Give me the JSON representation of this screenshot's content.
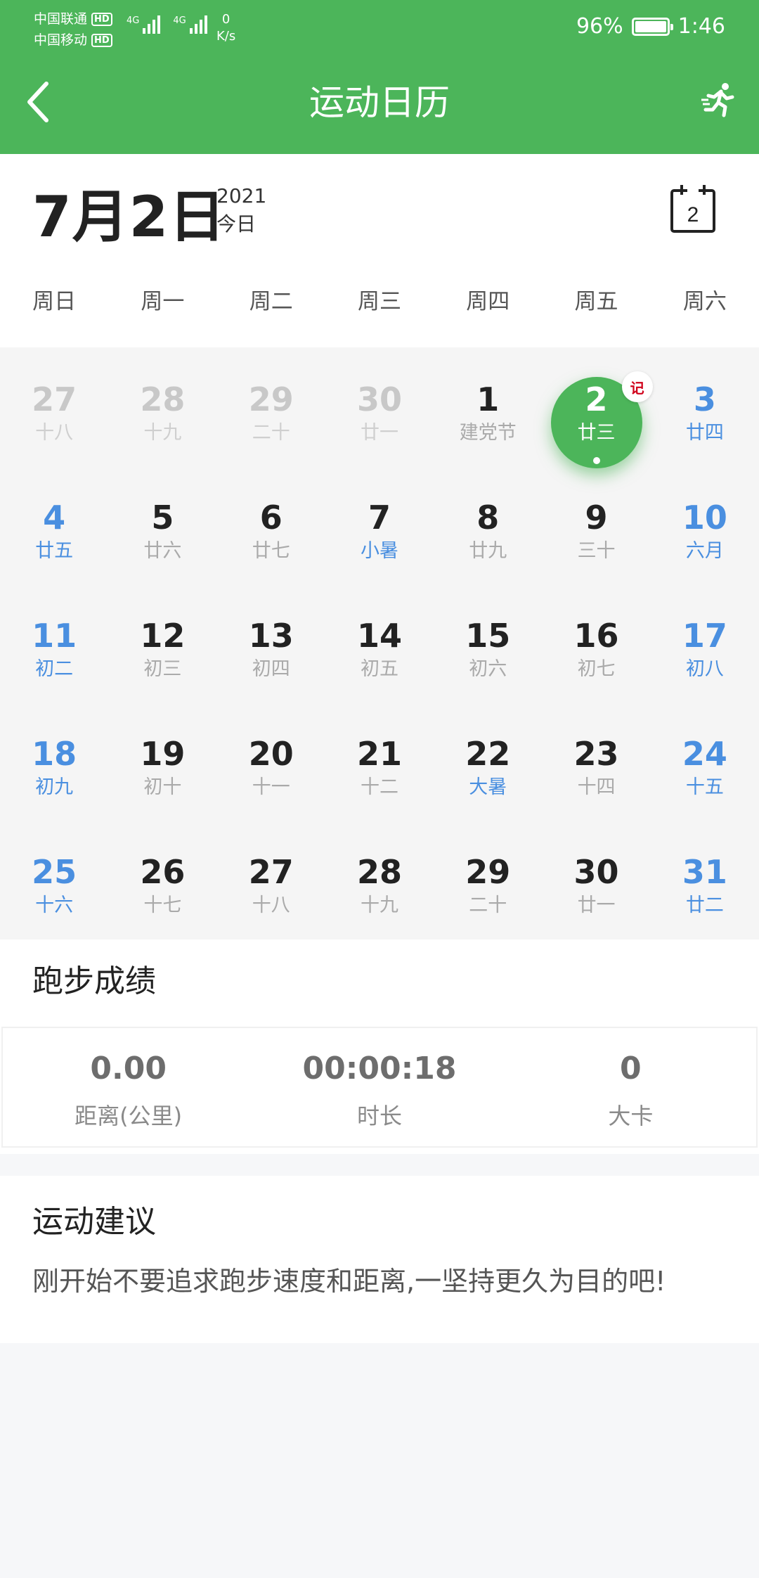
{
  "status_bar": {
    "carrier1": "中国联通",
    "carrier2": "中国移动",
    "hd": "HD",
    "net1": "4G",
    "net2": "4G",
    "speed_value": "0",
    "speed_unit": "K/s",
    "battery": "96%",
    "time": "1:46"
  },
  "nav": {
    "title": "运动日历"
  },
  "header": {
    "big_date": "7月2日",
    "year": "2021",
    "today_label": "今日",
    "calendar_icon_day": "2"
  },
  "weekdays": [
    "周日",
    "周一",
    "周二",
    "周三",
    "周四",
    "周五",
    "周六"
  ],
  "calendar": {
    "today_badge": "记",
    "days": [
      {
        "n": "27",
        "l": "十八",
        "outside": true
      },
      {
        "n": "28",
        "l": "十九",
        "outside": true
      },
      {
        "n": "29",
        "l": "二十",
        "outside": true
      },
      {
        "n": "30",
        "l": "廿一",
        "outside": true
      },
      {
        "n": "1",
        "l": "建党节"
      },
      {
        "n": "2",
        "l": "廿三",
        "today": true
      },
      {
        "n": "3",
        "l": "廿四",
        "weekend": true
      },
      {
        "n": "4",
        "l": "廿五",
        "weekend": true
      },
      {
        "n": "5",
        "l": "廿六"
      },
      {
        "n": "6",
        "l": "廿七"
      },
      {
        "n": "7",
        "l": "小暑",
        "blue_sub": true
      },
      {
        "n": "8",
        "l": "廿九"
      },
      {
        "n": "9",
        "l": "三十"
      },
      {
        "n": "10",
        "l": "六月",
        "weekend": true
      },
      {
        "n": "11",
        "l": "初二",
        "weekend": true
      },
      {
        "n": "12",
        "l": "初三"
      },
      {
        "n": "13",
        "l": "初四"
      },
      {
        "n": "14",
        "l": "初五"
      },
      {
        "n": "15",
        "l": "初六"
      },
      {
        "n": "16",
        "l": "初七"
      },
      {
        "n": "17",
        "l": "初八",
        "weekend": true
      },
      {
        "n": "18",
        "l": "初九",
        "weekend": true
      },
      {
        "n": "19",
        "l": "初十"
      },
      {
        "n": "20",
        "l": "十一"
      },
      {
        "n": "21",
        "l": "十二"
      },
      {
        "n": "22",
        "l": "大暑",
        "blue_sub": true
      },
      {
        "n": "23",
        "l": "十四"
      },
      {
        "n": "24",
        "l": "十五",
        "weekend": true
      },
      {
        "n": "25",
        "l": "十六",
        "weekend": true
      },
      {
        "n": "26",
        "l": "十七"
      },
      {
        "n": "27",
        "l": "十八"
      },
      {
        "n": "28",
        "l": "十九"
      },
      {
        "n": "29",
        "l": "二十"
      },
      {
        "n": "30",
        "l": "廿一"
      },
      {
        "n": "31",
        "l": "廿二",
        "weekend": true
      }
    ]
  },
  "results": {
    "title": "跑步成绩",
    "distance_value": "0.00",
    "distance_label": "距离(公里)",
    "duration_value": "00:00:18",
    "duration_label": "时长",
    "calories_value": "0",
    "calories_label": "大卡"
  },
  "advice": {
    "title": "运动建议",
    "text": "刚开始不要追求跑步速度和距离,一坚持更久为目的吧!"
  },
  "colors": {
    "brand_green": "#4cb55a",
    "weekend_blue": "#4a8fe0",
    "badge_red": "#d0021b"
  },
  "icons": {
    "back": "chevron-left-icon",
    "run": "running-man-icon",
    "calendar": "calendar-today-icon"
  }
}
